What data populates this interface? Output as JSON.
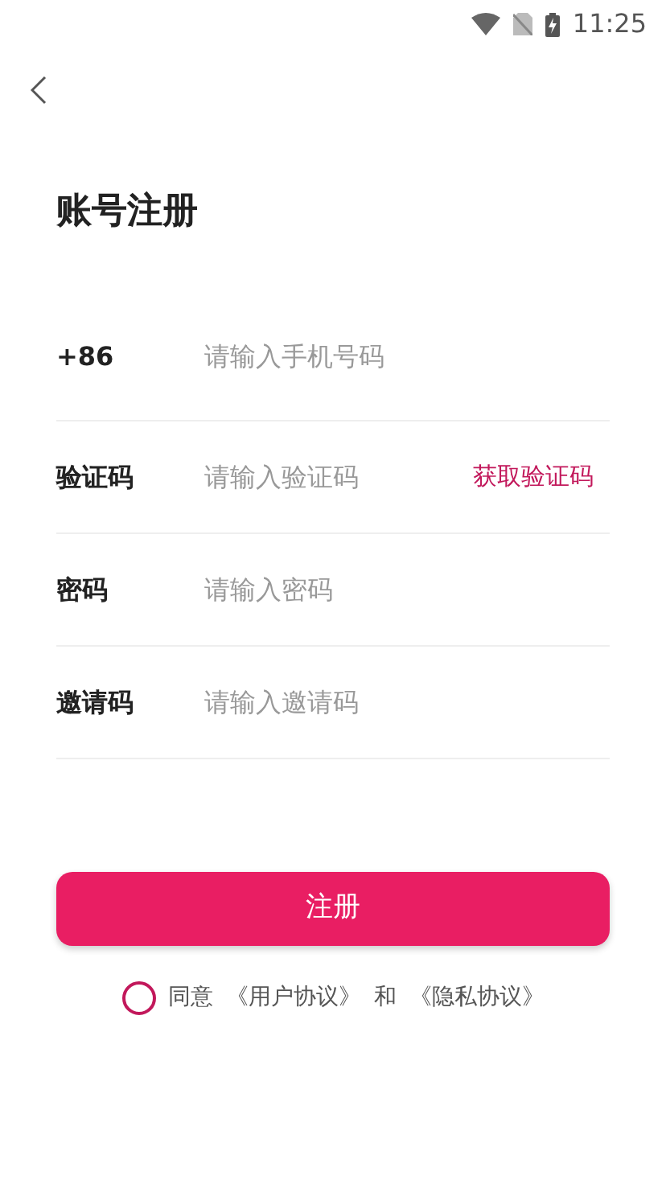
{
  "status_bar": {
    "time": "11:25"
  },
  "title": "账号注册",
  "fields": [
    {
      "label": "+86",
      "placeholder": "请输入手机号码"
    },
    {
      "label": "验证码",
      "placeholder": "请输入验证码",
      "action": "获取验证码"
    },
    {
      "label": "密码",
      "placeholder": "请输入密码"
    },
    {
      "label": "邀请码",
      "placeholder": "请输入邀请码"
    }
  ],
  "submit": "注册",
  "agreement": {
    "checked": false,
    "prefix": "同意",
    "user_agreement": "《用户协议》",
    "conjunction": "和",
    "privacy_policy": "《隐私协议》"
  }
}
